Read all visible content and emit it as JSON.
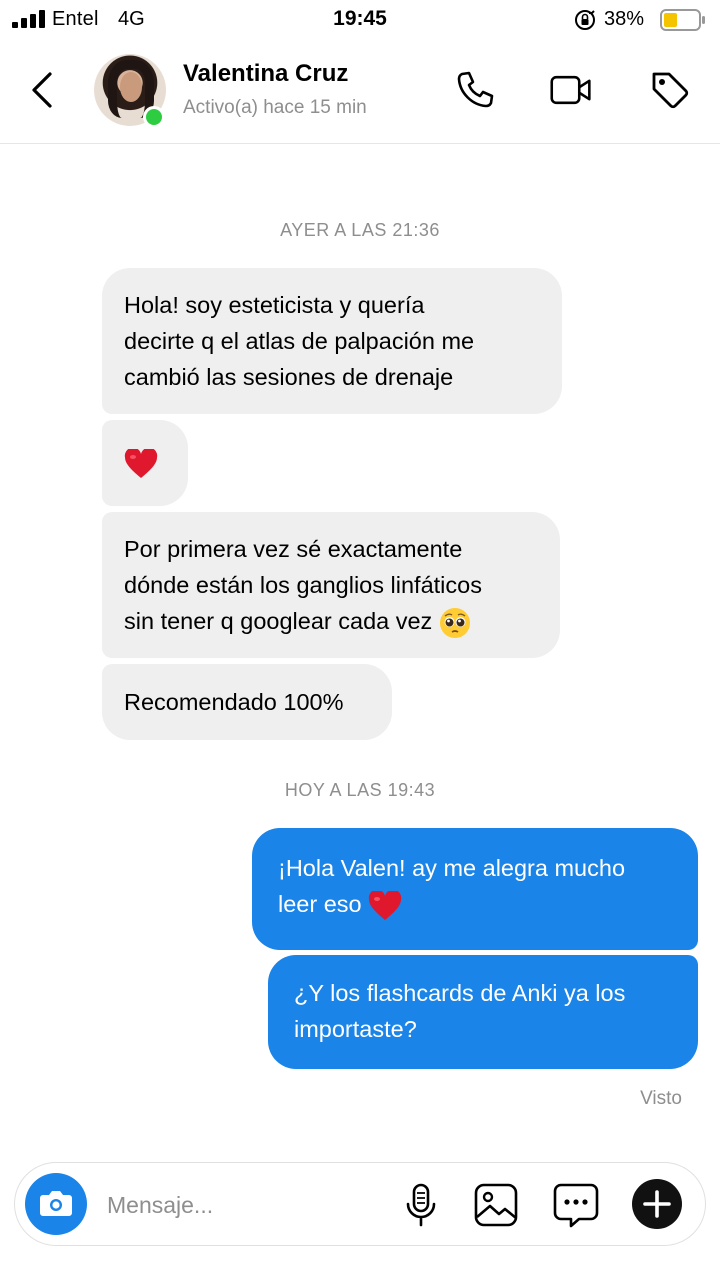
{
  "status_bar": {
    "carrier": "Entel",
    "network": "4G",
    "time": "19:45",
    "battery_percent": "38%",
    "battery_level": 0.38,
    "battery_color": "#f5c400"
  },
  "header": {
    "contact_name": "Valentina Cruz",
    "contact_status": "Activo(a) hace 15 min",
    "online_color": "#2ecc40",
    "icons": [
      "back-chevron-icon",
      "phone-icon",
      "video-camera-icon",
      "tag-icon"
    ]
  },
  "chat": {
    "timestamp_1": "AYER A LAS 21:36",
    "timestamp_2": "HOY A LAS 19:43",
    "incoming": [
      {
        "lines": [
          "Hola! soy esteticista y quería",
          "decirte q el atlas de palpación me",
          "cambió las sesiones de drenaje"
        ]
      },
      {
        "emoji": "red-heart"
      },
      {
        "lines": [
          "Por primera vez sé exactamente",
          "dónde están los ganglios linfáticos",
          "sin tener q googlear cada vez"
        ],
        "emoji": "pleading-face"
      },
      {
        "lines": [
          "Recomendado 100%"
        ]
      }
    ],
    "outgoing": [
      {
        "lines": [
          "¡Hola Valen! ay me alegra mucho",
          "leer eso"
        ],
        "emoji": "red-heart"
      },
      {
        "lines": [
          "¿Y los flashcards de Anki ya los",
          "importaste?"
        ]
      }
    ],
    "seen_label": "Visto",
    "incoming_color": "#efefef",
    "outgoing_color": "#1a84e8"
  },
  "composer": {
    "placeholder": "Mensaje...",
    "icons": [
      "camera-icon",
      "microphone-icon",
      "gallery-icon",
      "sticker-icon",
      "plus-icon"
    ]
  }
}
